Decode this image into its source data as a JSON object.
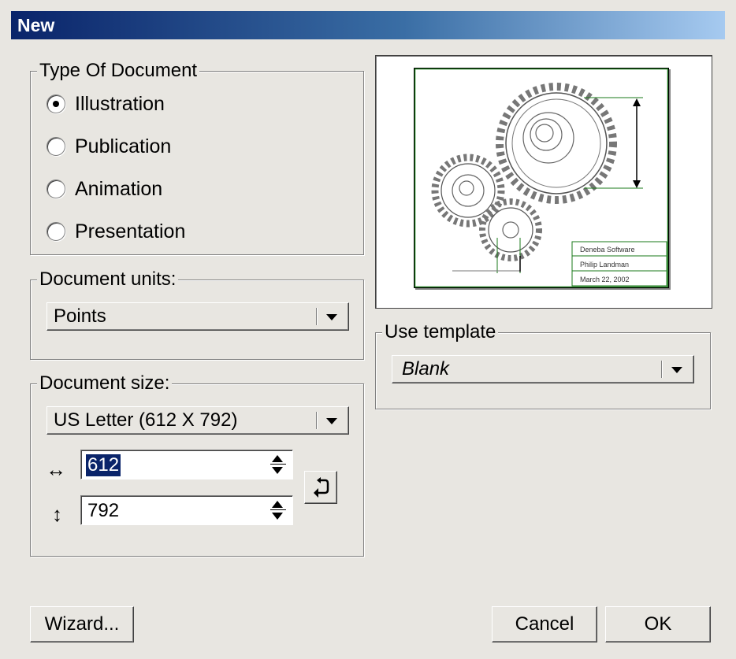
{
  "window": {
    "title": "New"
  },
  "type_of_document": {
    "legend": "Type Of Document",
    "options": [
      {
        "label": "Illustration",
        "checked": true
      },
      {
        "label": "Publication",
        "checked": false
      },
      {
        "label": "Animation",
        "checked": false
      },
      {
        "label": "Presentation",
        "checked": false
      }
    ]
  },
  "document_units": {
    "legend": "Document units:",
    "value": "Points"
  },
  "document_size": {
    "legend": "Document size:",
    "preset": "US Letter (612 X 792)",
    "width_value": "612",
    "height_value": "792",
    "width_icon": "horizontal-double-arrow-icon",
    "height_icon": "vertical-double-arrow-icon",
    "swap_icon": "rotate-orientation-icon"
  },
  "preview": {
    "title_block": [
      "Deneba Software",
      "Philip Landman",
      "March 22, 2002"
    ]
  },
  "use_template": {
    "legend": "Use template",
    "value": "Blank"
  },
  "buttons": {
    "wizard": "Wizard...",
    "cancel": "Cancel",
    "ok": "OK"
  },
  "colors": {
    "titlebar_start": "#0a246a",
    "titlebar_end": "#a6caf0",
    "selection": "#0a246a",
    "dialog_bg": "#e8e6e1",
    "preview_accent": "#1a7a1a"
  }
}
